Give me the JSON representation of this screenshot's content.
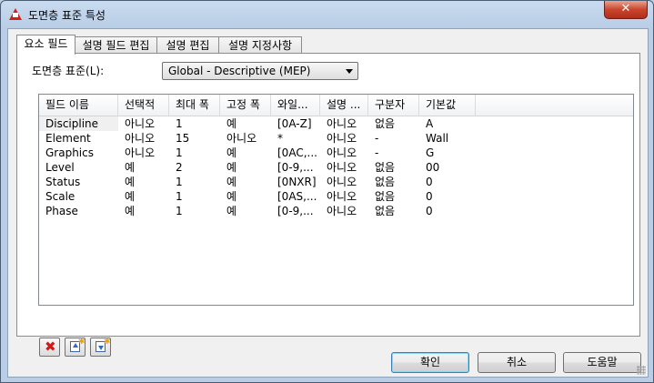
{
  "window": {
    "title": "도면층 표준 특성",
    "close_glyph": "✕"
  },
  "tabs": [
    {
      "label": "요소 필드"
    },
    {
      "label": "설명 필드 편집"
    },
    {
      "label": "설명 편집"
    },
    {
      "label": "설명 지정사항"
    }
  ],
  "standard": {
    "label": "도면층 표준(L):",
    "value": "Global - Descriptive (MEP)"
  },
  "list": {
    "columns": [
      "필드 이름",
      "선택적",
      "최대 폭",
      "고정 폭",
      "와일...",
      "설명 ...",
      "구분자",
      "기본값"
    ],
    "rows": [
      [
        "Discipline",
        "아니오",
        "1",
        "예",
        "[0A-Z]",
        "아니오",
        "없음",
        "A"
      ],
      [
        "Element",
        "아니오",
        "15",
        "아니오",
        "*",
        "아니오",
        "-",
        "Wall"
      ],
      [
        "Graphics",
        "아니오",
        "1",
        "예",
        "[0AC,...",
        "아니오",
        "-",
        "G"
      ],
      [
        "Level",
        "예",
        "2",
        "예",
        "[0-9,...",
        "아니오",
        "없음",
        "00"
      ],
      [
        "Status",
        "예",
        "1",
        "예",
        "[0NXR]",
        "아니오",
        "없음",
        "0"
      ],
      [
        "Scale",
        "예",
        "1",
        "예",
        "[0AS,...",
        "아니오",
        "없음",
        "0"
      ],
      [
        "Phase",
        "예",
        "1",
        "예",
        "[0-9,...",
        "아니오",
        "없음",
        "0"
      ]
    ]
  },
  "icons": {
    "delete": "delete-icon",
    "move_up": "move-up-icon",
    "move_down": "move-down-icon"
  },
  "buttons": {
    "ok": "확인",
    "cancel": "취소",
    "help": "도움말"
  }
}
